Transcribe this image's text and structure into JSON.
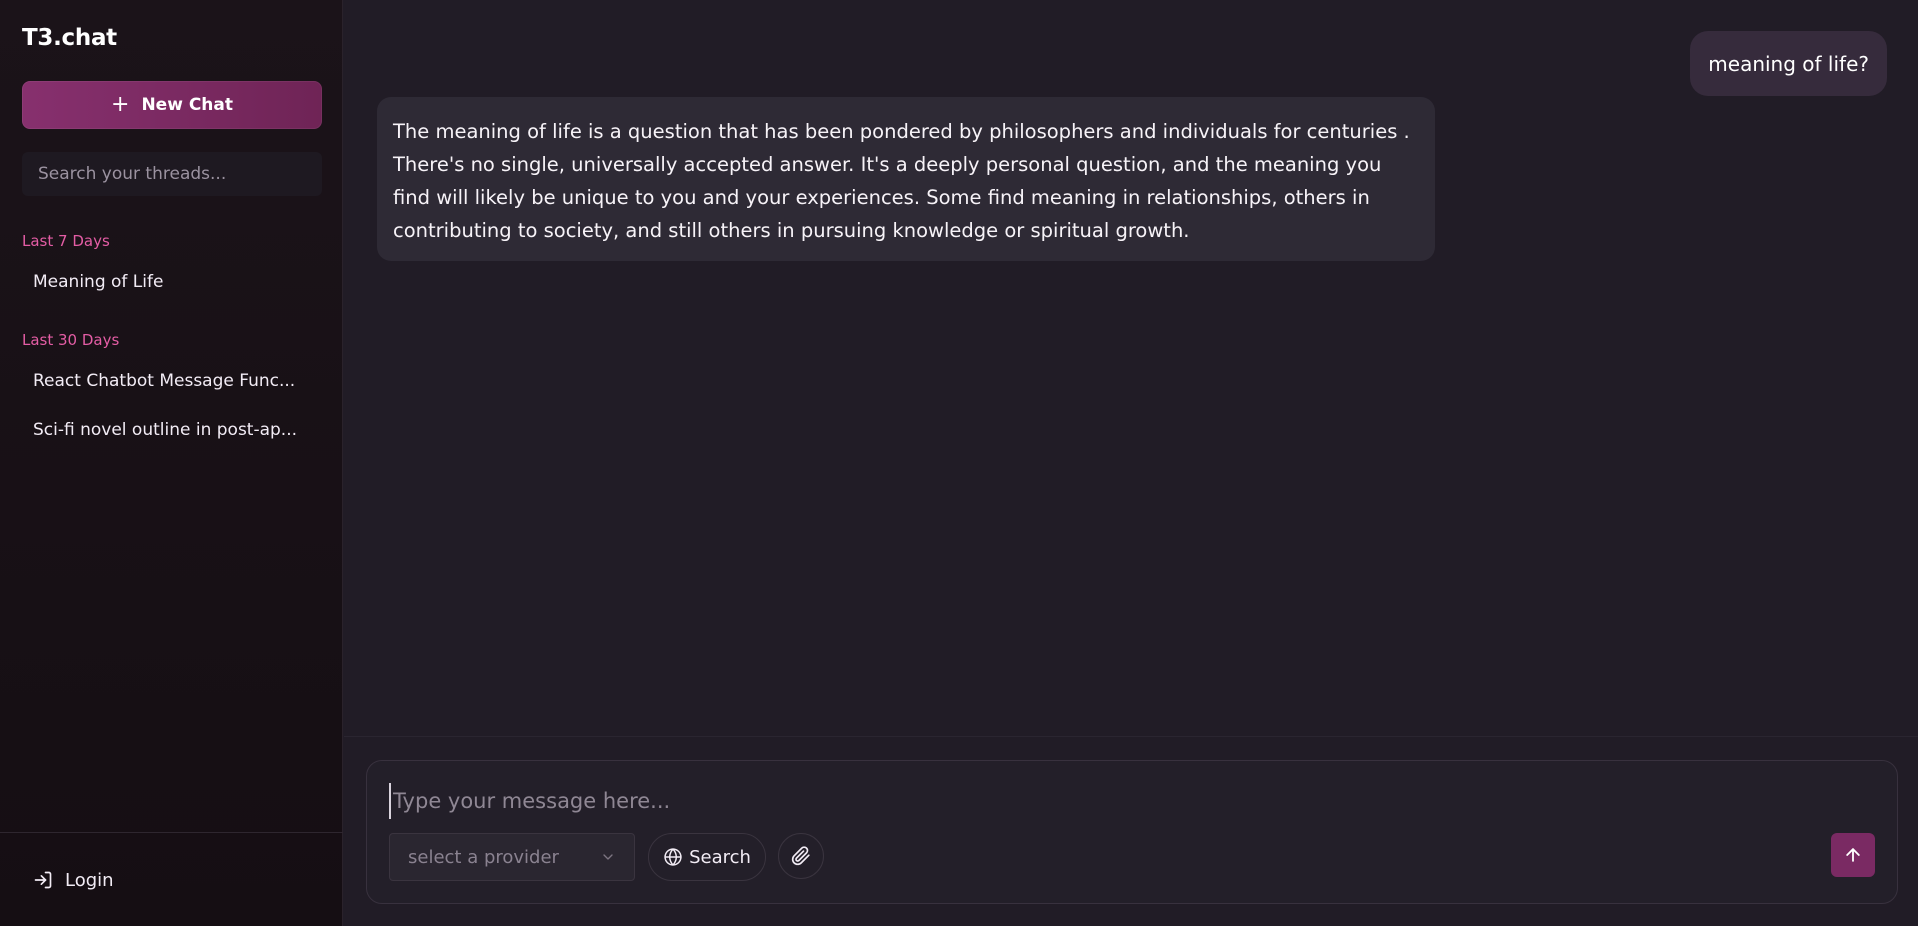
{
  "app": {
    "title": "T3.chat"
  },
  "sidebar": {
    "new_chat_label": "New Chat",
    "search_placeholder": "Search your threads...",
    "groups": [
      {
        "label": "Last 7 Days",
        "threads": [
          "Meaning of Life"
        ]
      },
      {
        "label": "Last 30 Days",
        "threads": [
          "React Chatbot Message Func...",
          "Sci-fi novel outline in post-ap..."
        ]
      }
    ],
    "login_label": "Login"
  },
  "chat": {
    "messages": [
      {
        "role": "user",
        "text": "meaning of life?"
      },
      {
        "role": "assistant",
        "text": "The meaning of life is a question that has been pondered by philosophers and individuals for centuries . There's no single, universally accepted answer. It's a deeply personal question, and the meaning you find will likely be unique to you and your experiences. Some find meaning in relationships, others in contributing to society, and still others in pursuing knowledge or spiritual growth."
      }
    ]
  },
  "composer": {
    "placeholder": "Type your message here...",
    "provider_placeholder": "select a provider",
    "search_label": "Search"
  },
  "icons": {
    "new_chat": "plus-icon",
    "provider": "chevron-down-icon",
    "search": "globe-icon",
    "attach": "paperclip-icon",
    "send": "arrow-up-icon",
    "login": "login-icon"
  },
  "colors": {
    "accent": "#87306e",
    "accent_dark": "#6f2456",
    "group_label": "#e45da5",
    "background": "#211c26",
    "sidebar_bg": "#1b1319",
    "user_bubble": "#362b3c",
    "assistant_bubble": "#2e2a35",
    "send_button": "#7a2a63"
  }
}
